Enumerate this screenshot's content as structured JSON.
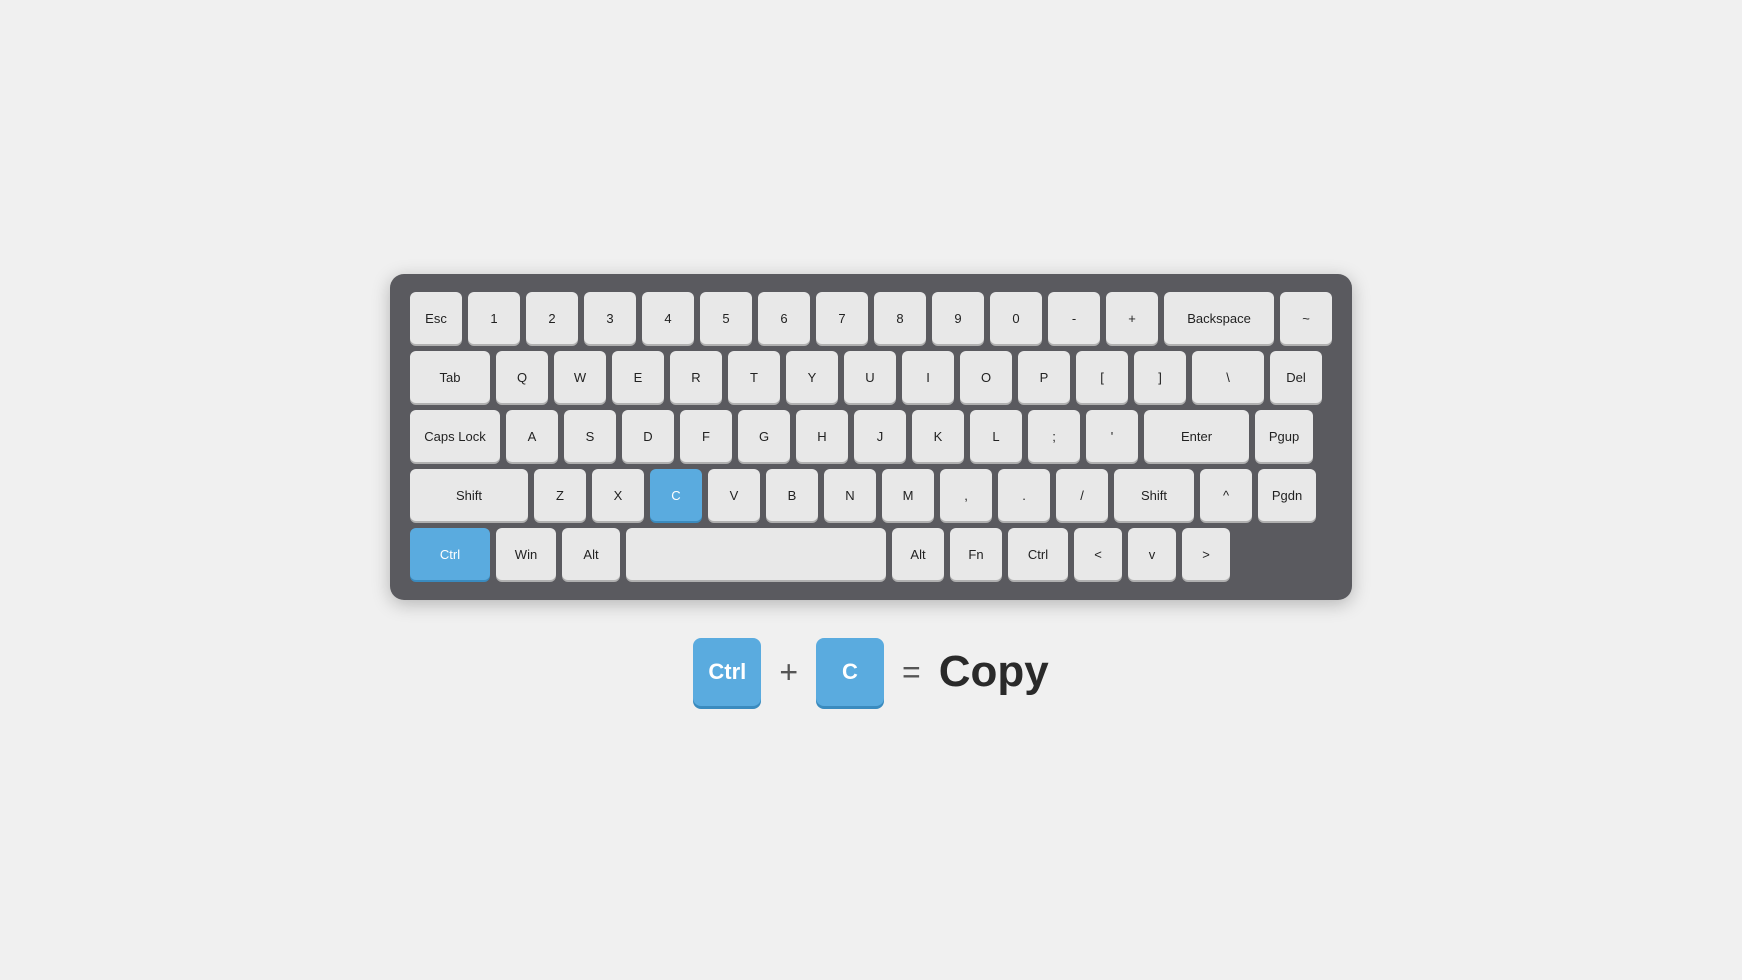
{
  "keyboard": {
    "rows": [
      {
        "id": "row1",
        "keys": [
          {
            "label": "Esc",
            "class": "key-esc",
            "highlight": false
          },
          {
            "label": "1",
            "class": "",
            "highlight": false
          },
          {
            "label": "2",
            "class": "",
            "highlight": false
          },
          {
            "label": "3",
            "class": "",
            "highlight": false
          },
          {
            "label": "4",
            "class": "",
            "highlight": false
          },
          {
            "label": "5",
            "class": "",
            "highlight": false
          },
          {
            "label": "6",
            "class": "",
            "highlight": false
          },
          {
            "label": "7",
            "class": "",
            "highlight": false
          },
          {
            "label": "8",
            "class": "",
            "highlight": false
          },
          {
            "label": "9",
            "class": "",
            "highlight": false
          },
          {
            "label": "0",
            "class": "",
            "highlight": false
          },
          {
            "label": "-",
            "class": "",
            "highlight": false
          },
          {
            "label": "+",
            "class": "",
            "highlight": false
          },
          {
            "label": "Backspace",
            "class": "key-backspace",
            "highlight": false
          },
          {
            "label": "~",
            "class": "key-tilde",
            "highlight": false
          }
        ]
      },
      {
        "id": "row2",
        "keys": [
          {
            "label": "Tab",
            "class": "key-tab",
            "highlight": false
          },
          {
            "label": "Q",
            "class": "",
            "highlight": false
          },
          {
            "label": "W",
            "class": "",
            "highlight": false
          },
          {
            "label": "E",
            "class": "",
            "highlight": false
          },
          {
            "label": "R",
            "class": "",
            "highlight": false
          },
          {
            "label": "T",
            "class": "",
            "highlight": false
          },
          {
            "label": "Y",
            "class": "",
            "highlight": false
          },
          {
            "label": "U",
            "class": "",
            "highlight": false
          },
          {
            "label": "I",
            "class": "",
            "highlight": false
          },
          {
            "label": "O",
            "class": "",
            "highlight": false
          },
          {
            "label": "P",
            "class": "",
            "highlight": false
          },
          {
            "label": "[",
            "class": "",
            "highlight": false
          },
          {
            "label": "]",
            "class": "",
            "highlight": false
          },
          {
            "label": "\\",
            "class": "key-backslash",
            "highlight": false
          },
          {
            "label": "Del",
            "class": "key-del",
            "highlight": false
          }
        ]
      },
      {
        "id": "row3",
        "keys": [
          {
            "label": "Caps Lock",
            "class": "key-capslock",
            "highlight": false
          },
          {
            "label": "A",
            "class": "",
            "highlight": false
          },
          {
            "label": "S",
            "class": "",
            "highlight": false
          },
          {
            "label": "D",
            "class": "",
            "highlight": false
          },
          {
            "label": "F",
            "class": "",
            "highlight": false
          },
          {
            "label": "G",
            "class": "",
            "highlight": false
          },
          {
            "label": "H",
            "class": "",
            "highlight": false
          },
          {
            "label": "J",
            "class": "",
            "highlight": false
          },
          {
            "label": "K",
            "class": "",
            "highlight": false
          },
          {
            "label": "L",
            "class": "",
            "highlight": false
          },
          {
            "label": ";",
            "class": "",
            "highlight": false
          },
          {
            "label": "'",
            "class": "",
            "highlight": false
          },
          {
            "label": "Enter",
            "class": "key-enter",
            "highlight": false
          },
          {
            "label": "Pgup",
            "class": "key-pgup",
            "highlight": false
          }
        ]
      },
      {
        "id": "row4",
        "keys": [
          {
            "label": "Shift",
            "class": "key-shift-left",
            "highlight": false
          },
          {
            "label": "Z",
            "class": "",
            "highlight": false
          },
          {
            "label": "X",
            "class": "",
            "highlight": false
          },
          {
            "label": "C",
            "class": "",
            "highlight": true
          },
          {
            "label": "V",
            "class": "",
            "highlight": false
          },
          {
            "label": "B",
            "class": "",
            "highlight": false
          },
          {
            "label": "N",
            "class": "",
            "highlight": false
          },
          {
            "label": "M",
            "class": "",
            "highlight": false
          },
          {
            "label": ",",
            "class": "",
            "highlight": false
          },
          {
            "label": ".",
            "class": "",
            "highlight": false
          },
          {
            "label": "/",
            "class": "",
            "highlight": false
          },
          {
            "label": "Shift",
            "class": "key-shift-right",
            "highlight": false
          },
          {
            "label": "^",
            "class": "key-caret",
            "highlight": false
          },
          {
            "label": "Pgdn",
            "class": "key-pgdn",
            "highlight": false
          }
        ]
      },
      {
        "id": "row5",
        "keys": [
          {
            "label": "Ctrl",
            "class": "key-ctrl-left",
            "highlight": true
          },
          {
            "label": "Win",
            "class": "key-win",
            "highlight": false
          },
          {
            "label": "Alt",
            "class": "key-alt",
            "highlight": false
          },
          {
            "label": "",
            "class": "key-space",
            "highlight": false
          },
          {
            "label": "Alt",
            "class": "key-alt-r",
            "highlight": false
          },
          {
            "label": "Fn",
            "class": "key-fn",
            "highlight": false
          },
          {
            "label": "Ctrl",
            "class": "key-ctrl-right",
            "highlight": false
          },
          {
            "label": "<",
            "class": "key-arrow",
            "highlight": false
          },
          {
            "label": "v",
            "class": "key-arrow",
            "highlight": false
          },
          {
            "label": ">",
            "class": "key-arrow",
            "highlight": false
          }
        ]
      }
    ]
  },
  "shortcut": {
    "key1": "Ctrl",
    "plus": "+",
    "key2": "C",
    "equals": "=",
    "action": "Copy"
  }
}
